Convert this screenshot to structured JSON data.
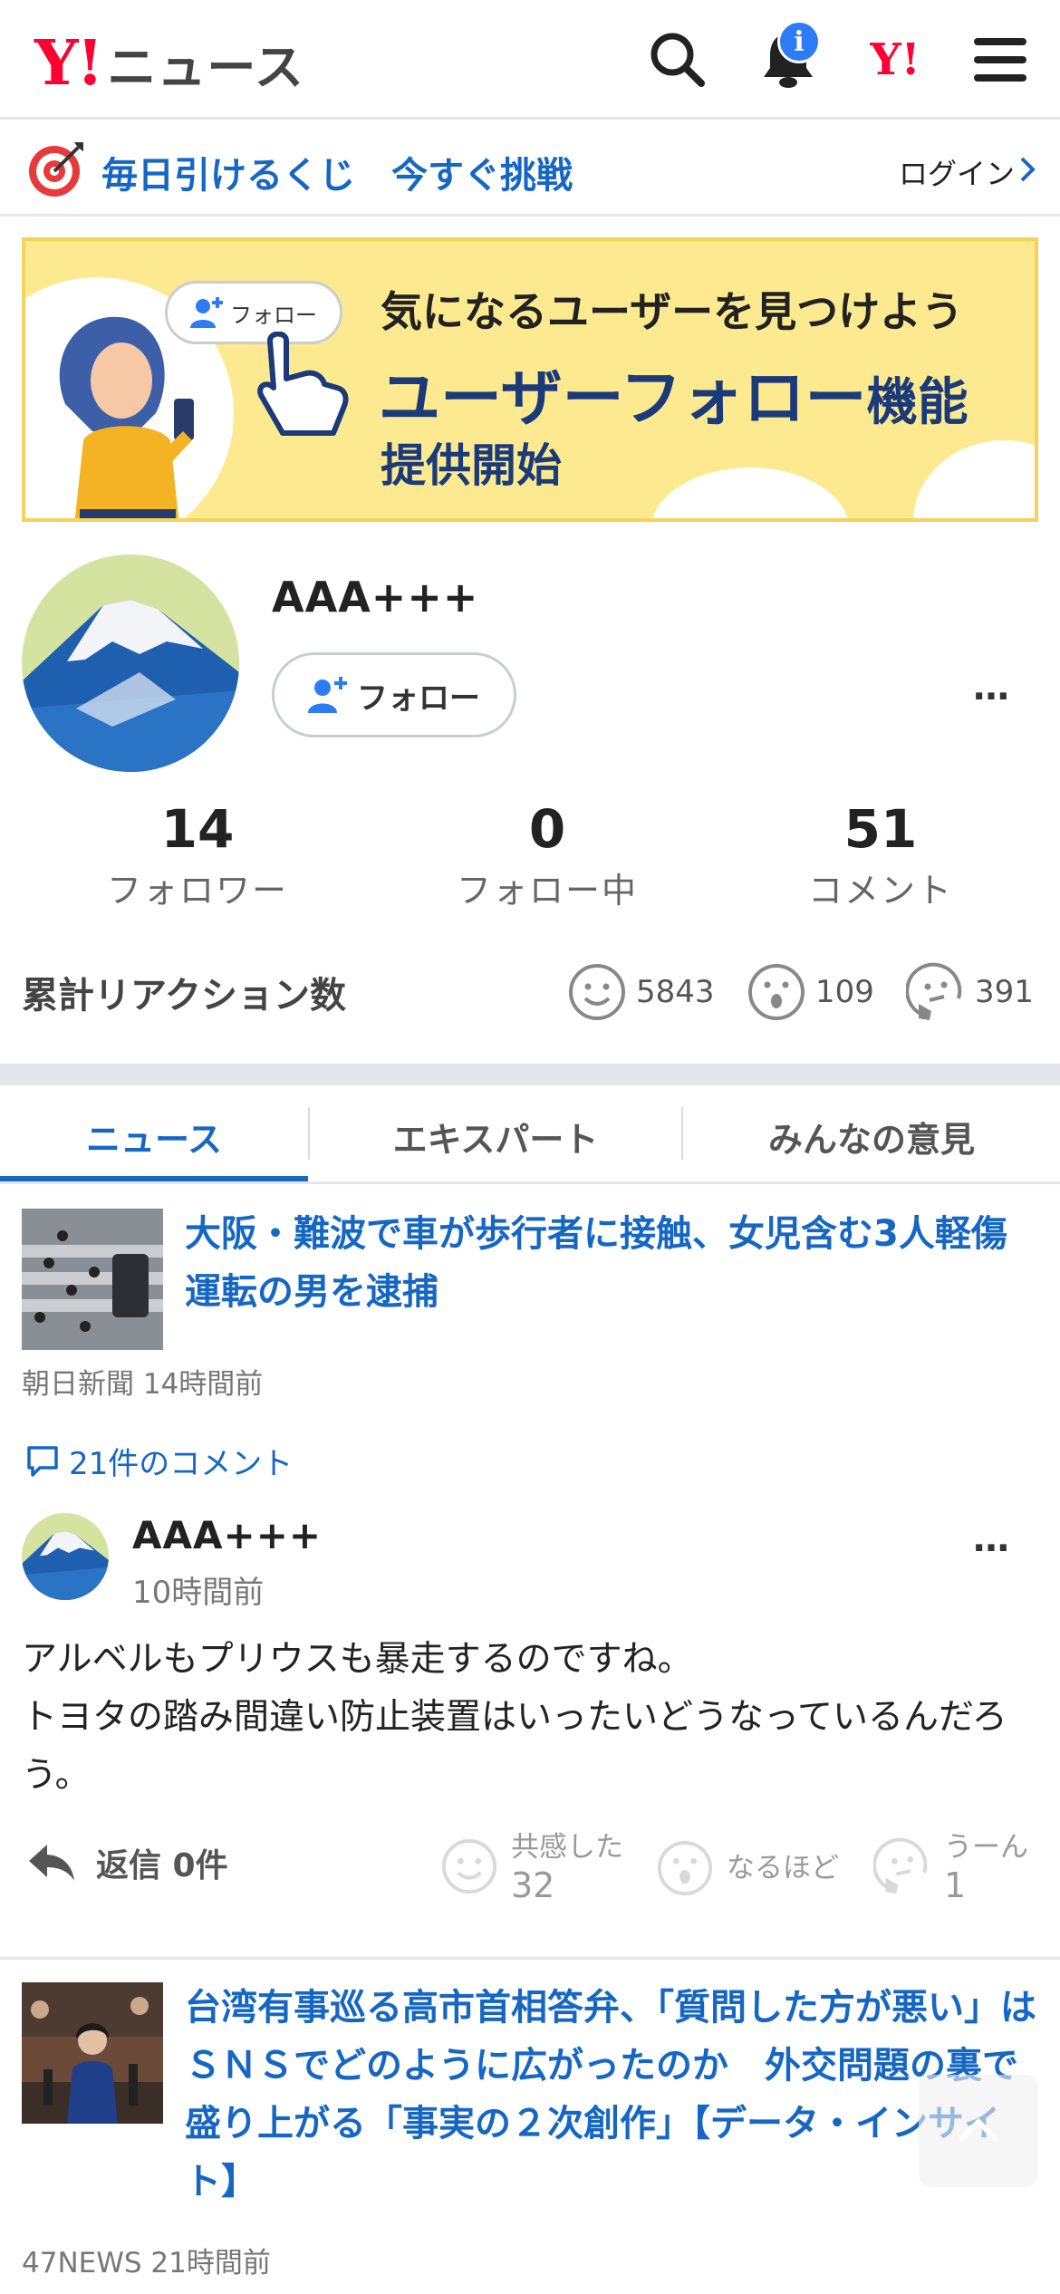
{
  "header": {
    "logo_mark": "Y!",
    "logo_word": "ニュース",
    "notification_badge": "i",
    "yahoo_mark": "Y!"
  },
  "lottery": {
    "text": "毎日引けるくじ　今すぐ挑戦",
    "login": "ログイン"
  },
  "banner": {
    "pill_label": "フォロー",
    "line1": "気になるユーザーを見つけよう",
    "line2_main": "ユーザーフォロー",
    "line2_suffix": "機能",
    "line3": "提供開始"
  },
  "profile": {
    "username": "AAA+++",
    "follow_label": "フォロー",
    "more": "…",
    "stats": [
      {
        "num": "14",
        "label": "フォロワー"
      },
      {
        "num": "0",
        "label": "フォロー中"
      },
      {
        "num": "51",
        "label": "コメント"
      }
    ],
    "reactions_title": "累計リアクション数",
    "reactions": [
      {
        "icon": "smile-face-icon",
        "count": "5843"
      },
      {
        "icon": "surprised-face-icon",
        "count": "109"
      },
      {
        "icon": "thinking-face-icon",
        "count": "391"
      }
    ]
  },
  "tabs": [
    "ニュース",
    "エキスパート",
    "みんなの意見"
  ],
  "articles": [
    {
      "title": "大阪・難波で車が歩行者に接触、女児含む3人軽傷　運転の男を逮捕",
      "meta": "朝日新聞 14時間前"
    },
    {
      "title": "台湾有事巡る高市首相答弁、「質問した方が悪い」はＳＮＳでどのように広がったのか　外交問題の裏で盛り上がる「事実の２次創作」【データ・インサイト】",
      "meta": "47NEWS 21時間前"
    }
  ],
  "comment": {
    "link": "21件のコメント",
    "username": "AAA+++",
    "time": "10時間前",
    "body_line1": "アルベルもプリウスも暴走するのですね。",
    "body_line2": "トヨタの踏み間違い防止装置はいったいどうなっているんだろう。",
    "reply": "返信 0件",
    "more": "…",
    "reactions": [
      {
        "label": "共感した",
        "count": "32",
        "icon": "smile-face-icon"
      },
      {
        "label": "なるほど",
        "count": "",
        "icon": "surprised-face-icon"
      },
      {
        "label": "うーん",
        "count": "1",
        "icon": "thinking-face-icon"
      }
    ]
  },
  "colors": {
    "link_blue": "#1667c4",
    "yahoo_red": "#ff0033",
    "banner_yellow": "#fde98f",
    "badge_blue": "#2d7cf6"
  }
}
